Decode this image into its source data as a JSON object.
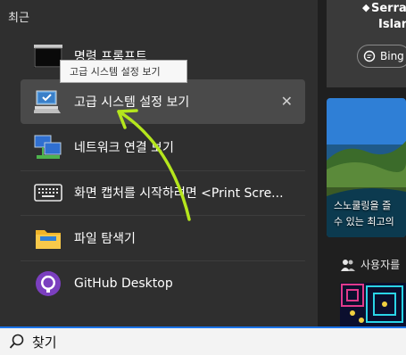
{
  "start": {
    "section_title": "최근",
    "items": [
      {
        "label": "명령 프롬프트",
        "icon": "command-prompt-icon"
      },
      {
        "label": "고급 시스템 설정 보기",
        "icon": "system-settings-icon",
        "selected": true
      },
      {
        "label": "네트워크 연결 보기",
        "icon": "network-connections-icon"
      },
      {
        "label": "화면 캡처를 시작하려면 <Print Scre...",
        "icon": "keyboard-icon"
      },
      {
        "label": "파일 탐색기",
        "icon": "folder-icon"
      },
      {
        "label": "GitHub Desktop",
        "icon": "github-icon"
      }
    ],
    "remove_glyph": "✕",
    "tooltip": "고급 시스템 설정 보기"
  },
  "right_panel": {
    "card1_line1": "Serra c",
    "card1_line2": "Islands",
    "bing_label": "Bing",
    "card2_line1": "스노쿨링을 즐",
    "card2_line2": "수 있는 최고의",
    "users_label": "사용자를"
  },
  "search": {
    "text": "찾기"
  },
  "colors": {
    "accent": "#1a73e8",
    "annotation_arrow": "#b5e61d"
  }
}
